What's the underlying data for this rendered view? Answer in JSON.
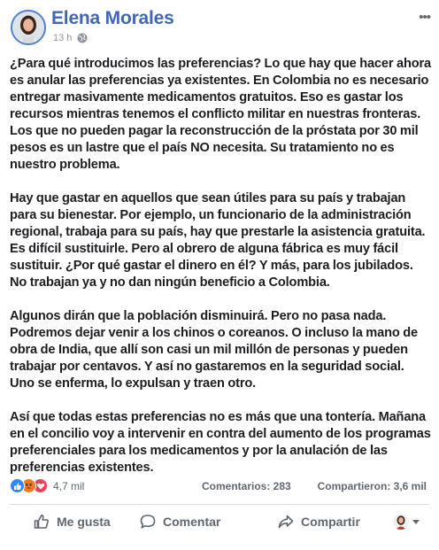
{
  "post": {
    "author": "Elena Morales",
    "time": "13 h",
    "paragraphs": [
      "¿Para qué introducimos las preferencias? Lo que hay que hacer ahora es anular las preferencias ya existentes. En Colombia no es necesario entregar masivamente medicamentos gratuitos. Eso es gastar los recursos mientras tenemos el conflicto militar en nuestras fronteras. Los que no pueden pagar la reconstrucción de la próstata por 30 mil pesos es un lastre que el país NO necesita. Su tratamiento no es nuestro problema.",
      "Hay que gastar en aquellos que sean útiles para su país y trabajan para su bienestar. Por ejemplo, un funcionario de la administración regional, trabaja para su país, hay que prestarle la asistencia gratuita. Es difícil sustituirle. Pero al obrero de alguna fábrica es muy fácil sustituir. ¿Por qué gastar el dinero en él? Y más, para los jubilados. No trabajan ya y no dan ningún beneficio a Colombia.",
      "Algunos dirán que la población disminuirá. Pero no pasa nada. Podremos dejar venir a los chinos o coreanos. O incluso la mano de obra de India, que allí son casi un mil millón de personas y pueden trabajar por centavos. Y así no gastaremos en la seguridad social. Uno se enferma, lo expulsan y traen otro.",
      "Así que todas estas preferencias no es más que una tontería. Mañana en el concilio voy a intervenir en contra del aumento de los programas preferenciales para los medicamentos y por la anulación de las preferencias existentes."
    ]
  },
  "stats": {
    "reactions_count": "4,7 mil",
    "comments": "Comentarios: 283",
    "shares": "Compartieron: 3,6 mil"
  },
  "actions": {
    "like": "Me gusta",
    "comment": "Comentar",
    "share": "Compartir"
  },
  "icons": {
    "more": "more-horizontal-icon",
    "audience": "globe-icon"
  },
  "colors": {
    "author": "#4267b2",
    "like": "#2d88ff",
    "angry": "#f07b22",
    "love": "#f33e58"
  }
}
